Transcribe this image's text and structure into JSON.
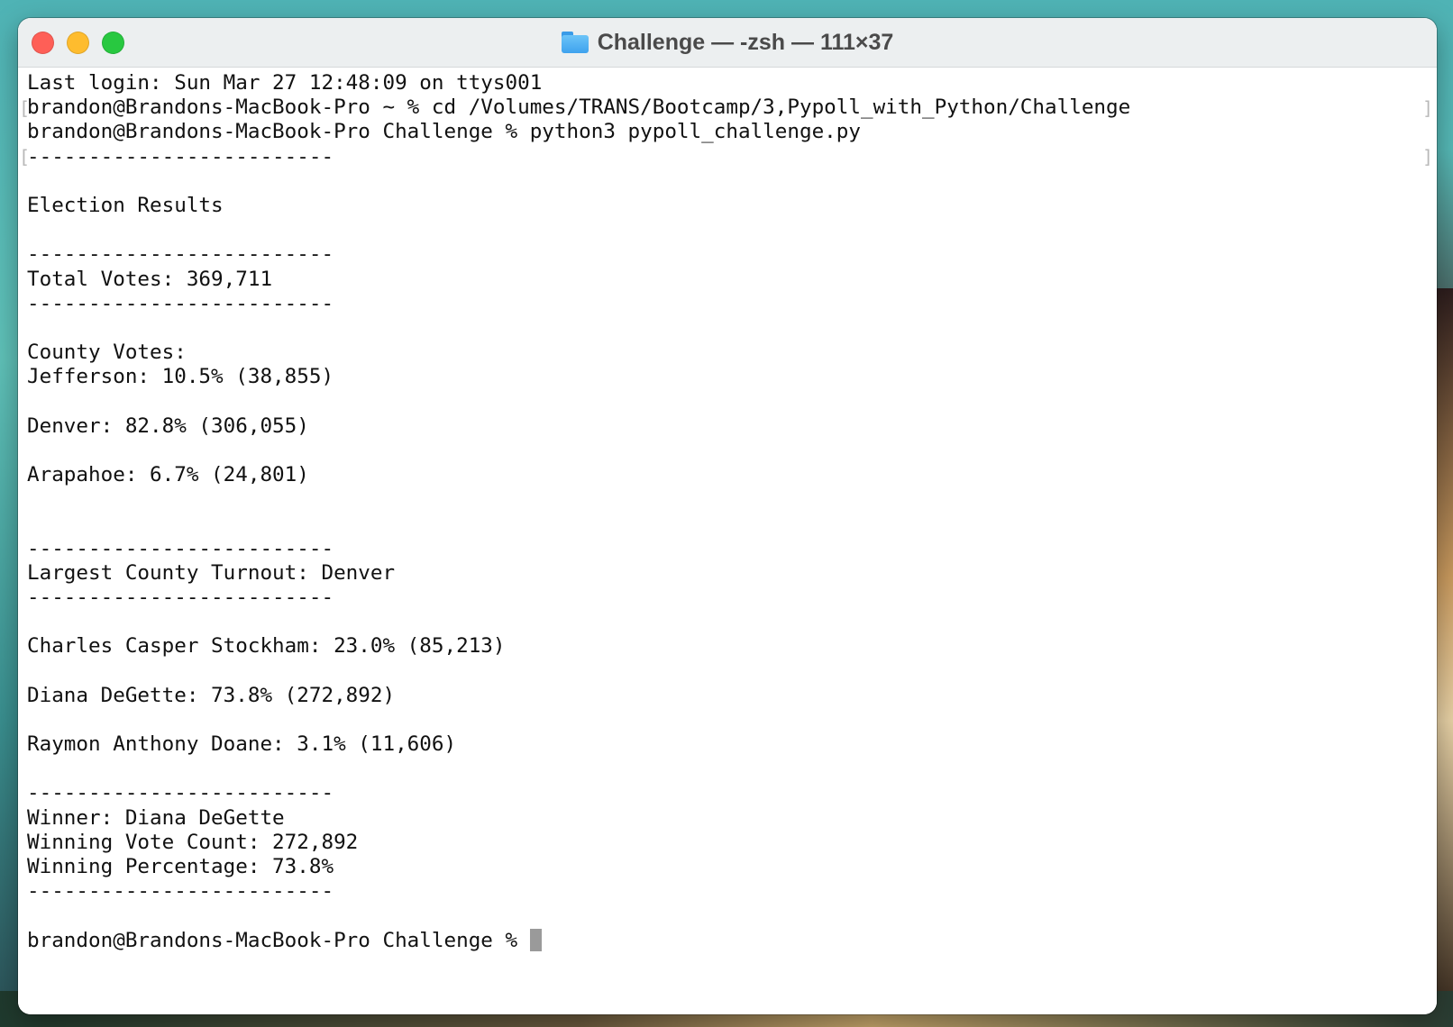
{
  "window": {
    "title": "Challenge — -zsh — 111×37",
    "title_icon": "folder-icon"
  },
  "terminal": {
    "lines": [
      "Last login: Sun Mar 27 12:48:09 on ttys001",
      "brandon@Brandons-MacBook-Pro ~ % cd /Volumes/TRANS/Bootcamp/3,Pypoll_with_Python/Challenge",
      "brandon@Brandons-MacBook-Pro Challenge % python3 pypoll_challenge.py",
      "-------------------------",
      "",
      "Election Results",
      "",
      "-------------------------",
      "Total Votes: 369,711",
      "-------------------------",
      "",
      "County Votes:",
      "Jefferson: 10.5% (38,855)",
      "",
      "Denver: 82.8% (306,055)",
      "",
      "Arapahoe: 6.7% (24,801)",
      "",
      "",
      "-------------------------",
      "Largest County Turnout: Denver",
      "-------------------------",
      "",
      "Charles Casper Stockham: 23.0% (85,213)",
      "",
      "Diana DeGette: 73.8% (272,892)",
      "",
      "Raymon Anthony Doane: 3.1% (11,606)",
      "",
      "-------------------------",
      "Winner: Diana DeGette",
      "Winning Vote Count: 272,892",
      "Winning Percentage: 73.8%",
      "-------------------------",
      "",
      "brandon@Brandons-MacBook-Pro Challenge % "
    ]
  },
  "colors": {
    "close": "#fe5f57",
    "minimize": "#febc2e",
    "zoom": "#28c840",
    "text": "#111111",
    "cursor": "#9a9a9a"
  }
}
